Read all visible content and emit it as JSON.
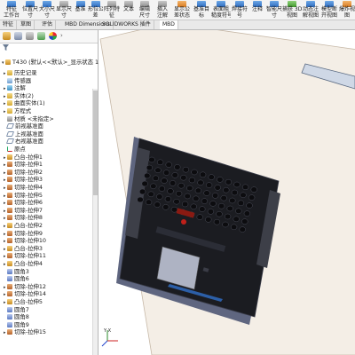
{
  "ribbon": {
    "items": [
      {
        "label": "特征\n工作台",
        "icon": "feature-icon",
        "color": "blue"
      },
      {
        "label": "位置尺\n寸",
        "icon": "dimension-icon",
        "color": "blue"
      },
      {
        "label": "大小尺\n寸",
        "icon": "size-dimension-icon",
        "color": "blue"
      },
      {
        "label": "显示尺\n寸",
        "icon": "show-dimension-icon",
        "color": "gray"
      },
      {
        "label": "基准",
        "icon": "datum-icon",
        "color": "blue"
      },
      {
        "label": "形位公\n差",
        "icon": "tolerance-icon",
        "color": "blue"
      },
      {
        "label": "阵列特\n征",
        "icon": "pattern-icon",
        "color": "gray"
      },
      {
        "label": "文本",
        "icon": "text-icon",
        "color": "gray"
      },
      {
        "label": "编辑\n尺寸",
        "icon": "edit-dimension-icon",
        "color": "gray"
      },
      {
        "label": "插入\n注解",
        "icon": "insert-annotation-icon",
        "color": "gray"
      },
      {
        "label": "显示公\n差状态",
        "icon": "tolerance-status-icon",
        "color": "orange"
      },
      {
        "label": "基准目\n标",
        "icon": "datum-target-icon",
        "color": "blue"
      },
      {
        "label": "表面粗\n糙度符号",
        "icon": "roughness-icon",
        "color": "blue"
      },
      {
        "label": "焊接符\n号",
        "icon": "weld-icon",
        "color": "blue"
      },
      {
        "label": "注释",
        "icon": "note-icon",
        "color": "blue"
      },
      {
        "label": "智能尺\n寸",
        "icon": "smart-dimension-icon",
        "color": "blue"
      },
      {
        "label": "捕获 3D\n视图",
        "icon": "capture-3d-view-icon",
        "color": "green"
      },
      {
        "label": "动态注\n解视图",
        "icon": "dynamic-annotation-icon",
        "color": "blue"
      },
      {
        "label": "模型断\n开视图",
        "icon": "break-view-icon",
        "color": "blue"
      },
      {
        "label": "爆炸视\n图",
        "icon": "explode-view-icon",
        "color": "orange"
      }
    ]
  },
  "tabs": [
    {
      "label": "特征",
      "active": false
    },
    {
      "label": "草图",
      "active": false
    },
    {
      "label": "评估",
      "active": false
    },
    {
      "label": "MBD Dimensions",
      "active": false
    },
    {
      "label": "SOLIDWORKS 插件",
      "active": false
    },
    {
      "label": "MBD",
      "active": true
    }
  ],
  "feature_manager": {
    "root": "T430 (默认<<默认>_显示状态 1>)",
    "nodes": [
      {
        "label": "历史记录",
        "icon": "history-icon",
        "kind": "folder",
        "expand": "▸"
      },
      {
        "label": "传感器",
        "icon": "sensor-icon",
        "kind": "sens",
        "expand": ""
      },
      {
        "label": "注解",
        "icon": "annotation-icon",
        "kind": "ann",
        "expand": "▸"
      },
      {
        "label": "实体(2)",
        "icon": "solid-bodies-icon",
        "kind": "folder",
        "expand": "▸"
      },
      {
        "label": "曲面实体(1)",
        "icon": "surface-bodies-icon",
        "kind": "folder",
        "expand": "▸"
      },
      {
        "label": "方程式",
        "icon": "equation-icon",
        "kind": "folder",
        "expand": "▸"
      },
      {
        "label": "材质 <未指定>",
        "icon": "material-icon",
        "kind": "mat",
        "expand": ""
      },
      {
        "label": "前视基准面",
        "icon": "plane-icon",
        "kind": "plane",
        "expand": ""
      },
      {
        "label": "上视基准面",
        "icon": "plane-icon",
        "kind": "plane",
        "expand": ""
      },
      {
        "label": "右视基准面",
        "icon": "plane-icon",
        "kind": "plane",
        "expand": ""
      },
      {
        "label": "原点",
        "icon": "origin-icon",
        "kind": "orig",
        "expand": ""
      },
      {
        "label": "凸台-拉伸1",
        "icon": "boss-extrude-icon",
        "kind": "feat",
        "expand": "▸"
      },
      {
        "label": "切除-拉伸1",
        "icon": "cut-extrude-icon",
        "kind": "cut",
        "expand": "▸"
      },
      {
        "label": "切除-拉伸2",
        "icon": "cut-extrude-icon",
        "kind": "cut",
        "expand": "▸"
      },
      {
        "label": "切除-拉伸3",
        "icon": "cut-extrude-icon",
        "kind": "cut",
        "expand": "▸"
      },
      {
        "label": "切除-拉伸4",
        "icon": "cut-extrude-icon",
        "kind": "cut",
        "expand": "▸"
      },
      {
        "label": "切除-拉伸5",
        "icon": "cut-extrude-icon",
        "kind": "cut",
        "expand": "▸"
      },
      {
        "label": "切除-拉伸6",
        "icon": "cut-extrude-icon",
        "kind": "cut",
        "expand": "▸"
      },
      {
        "label": "切除-拉伸7",
        "icon": "cut-extrude-icon",
        "kind": "cut",
        "expand": "▸"
      },
      {
        "label": "切除-拉伸8",
        "icon": "cut-extrude-icon",
        "kind": "cut",
        "expand": "▸"
      },
      {
        "label": "凸台-拉伸2",
        "icon": "boss-extrude-icon",
        "kind": "feat",
        "expand": "▸"
      },
      {
        "label": "切除-拉伸9",
        "icon": "cut-extrude-icon",
        "kind": "cut",
        "expand": "▸"
      },
      {
        "label": "切除-拉伸10",
        "icon": "cut-extrude-icon",
        "kind": "cut",
        "expand": "▸"
      },
      {
        "label": "凸台-拉伸3",
        "icon": "boss-extrude-icon",
        "kind": "feat",
        "expand": "▸"
      },
      {
        "label": "切除-拉伸11",
        "icon": "cut-extrude-icon",
        "kind": "cut",
        "expand": "▸"
      },
      {
        "label": "凸台-拉伸4",
        "icon": "boss-extrude-icon",
        "kind": "feat",
        "expand": "▸"
      },
      {
        "label": "圆角3",
        "icon": "fillet-icon",
        "kind": "fillet",
        "expand": ""
      },
      {
        "label": "圆角6",
        "icon": "fillet-icon",
        "kind": "fillet",
        "expand": ""
      },
      {
        "label": "切除-拉伸12",
        "icon": "cut-extrude-icon",
        "kind": "cut",
        "expand": "▸"
      },
      {
        "label": "切除-拉伸14",
        "icon": "cut-extrude-icon",
        "kind": "cut",
        "expand": "▸"
      },
      {
        "label": "凸台-拉伸5",
        "icon": "boss-extrude-icon",
        "kind": "feat",
        "expand": "▸"
      },
      {
        "label": "圆角7",
        "icon": "fillet-icon",
        "kind": "fillet",
        "expand": ""
      },
      {
        "label": "圆角8",
        "icon": "fillet-icon",
        "kind": "fillet",
        "expand": ""
      },
      {
        "label": "圆角9",
        "icon": "fillet-icon",
        "kind": "fillet",
        "expand": ""
      },
      {
        "label": "切除-拉伸15",
        "icon": "cut-extrude-icon",
        "kind": "cut",
        "expand": "▸"
      }
    ]
  },
  "graphics": {
    "model": "laptop-model",
    "axis_x": "X",
    "axis_y": "Y"
  }
}
